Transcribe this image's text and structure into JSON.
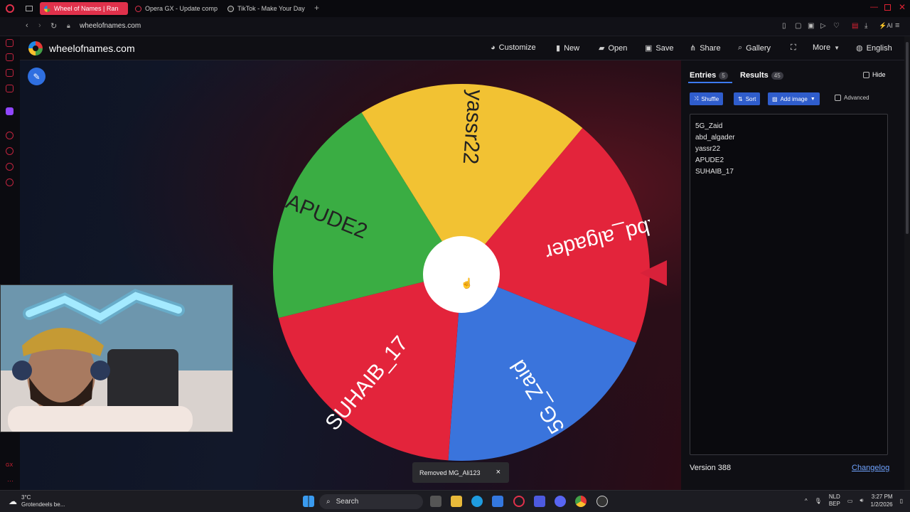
{
  "browser": {
    "tabs": [
      {
        "label": "Wheel of Names | Ran",
        "active": true
      },
      {
        "label": "Opera GX - Update comp"
      },
      {
        "label": "TikTok - Make Your Day"
      }
    ],
    "url": "wheelofnames.com"
  },
  "header": {
    "site_title": "wheelofnames.com",
    "buttons": {
      "customize": "Customize",
      "new": "New",
      "open": "Open",
      "save": "Save",
      "share": "Share",
      "gallery": "Gallery",
      "more": "More",
      "language": "English"
    }
  },
  "wheel": {
    "segments": [
      {
        "label": "yassr22",
        "color": "#f2c233"
      },
      {
        "label": "abd_algader",
        "color": "#e3243b"
      },
      {
        "label": "5G_Zaid",
        "color": "#3a74dc"
      },
      {
        "label": "SUHAIB_17",
        "color": "#e3243b"
      },
      {
        "label": "APUDE2",
        "color": "#3aad43"
      }
    ],
    "pointer_color": "#d8213a"
  },
  "toast": {
    "message": "Removed MG_Ali123",
    "close": "×"
  },
  "panel": {
    "tabs": {
      "entries_label": "Entries",
      "entries_count": "5",
      "results_label": "Results",
      "results_count": "45"
    },
    "hide_label": "Hide",
    "buttons": {
      "shuffle": "Shuffle",
      "sort": "Sort",
      "add_image": "Add image"
    },
    "advanced_label": "Advanced",
    "entries": [
      "5G_Zaid",
      "abd_algader",
      "yassr22",
      "APUDE2",
      "SUHAIB_17"
    ],
    "version": "Version 388",
    "changelog": "Changelog"
  },
  "taskbar": {
    "weather_temp": "3°C",
    "weather_text": "Grotendeels be...",
    "search": "Search",
    "lang_top": "NLD",
    "lang_bottom": "BEP",
    "time": "3:27 PM",
    "date": "1/2/2026"
  }
}
